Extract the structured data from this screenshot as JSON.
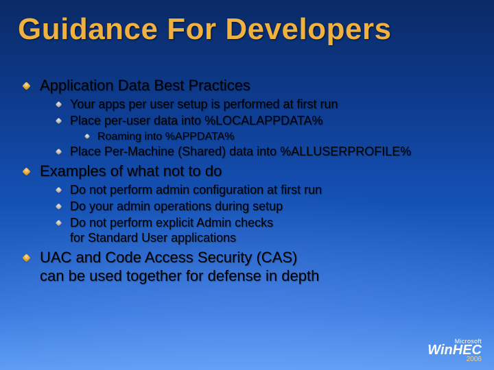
{
  "title": "Guidance For Developers",
  "bullets": {
    "item1": {
      "text": "Application Data Best Practices",
      "sub1": "Your apps per user setup is performed at first run",
      "sub2": "Place per-user data into %LOCALAPPDATA%",
      "sub2_sub1": "Roaming into %APPDATA%",
      "sub3": "Place Per-Machine (Shared) data into %ALLUSERPROFILE%"
    },
    "item2": {
      "text": "Examples of what not to do",
      "sub1": "Do not perform admin configuration at first run",
      "sub2": "Do your admin operations during setup",
      "sub3": "Do not perform explicit Admin checks\nfor Standard User applications"
    },
    "item3": {
      "text": "UAC and Code Access Security (CAS)\ncan be used together for defense in depth"
    }
  },
  "footer": {
    "brand_small": "Microsoft",
    "brand_main": "WinHEC",
    "year": "2006"
  }
}
